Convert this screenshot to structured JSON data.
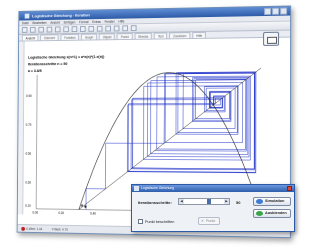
{
  "window": {
    "title": "Logistische Gleichung - Iteration"
  },
  "menu": [
    "Datei",
    "Bearbeiten",
    "Ansicht",
    "Einfügen",
    "Format",
    "Extras",
    "Fenster",
    "Hilfe"
  ],
  "tabs": {
    "items": [
      "Ansicht",
      "Element",
      "Funktion",
      "Graph",
      "Objekt",
      "Punkt",
      "Strecke",
      "Text"
    ],
    "right": [
      "Zuweisen",
      "Hilfe"
    ]
  },
  "plot": {
    "title_line": "Logistische Gleichung x(n+1) = a*x(n)*(1-x(n))",
    "iterations_line": "Iterationsschritte n = 50",
    "parameter_line": "a = 3.8/5",
    "point_label": "A",
    "y_ticks": [
      "0.90",
      "0.70",
      "0.50",
      "0.30",
      "0.10"
    ],
    "x_ticks": [
      "0.00",
      "0.20",
      "0.40"
    ],
    "colors": {
      "cobweb": "#1e30c8",
      "curve": "#222222",
      "axis": "#555555"
    }
  },
  "status": {
    "x_readout": "X-Wert: 1.44",
    "y_readout": "Y-Wert: 4.70"
  },
  "dialog": {
    "title": "Logistische Gleichung",
    "iterations_label": "Iterationsschritte:",
    "iterations_value": "50",
    "iterations_fraction": 0.62,
    "simulate_label": "Simulation",
    "abort_label": "Ausblenden",
    "checkbox_label": "Punkt beschriften",
    "small_button_label": "Punkt"
  }
}
